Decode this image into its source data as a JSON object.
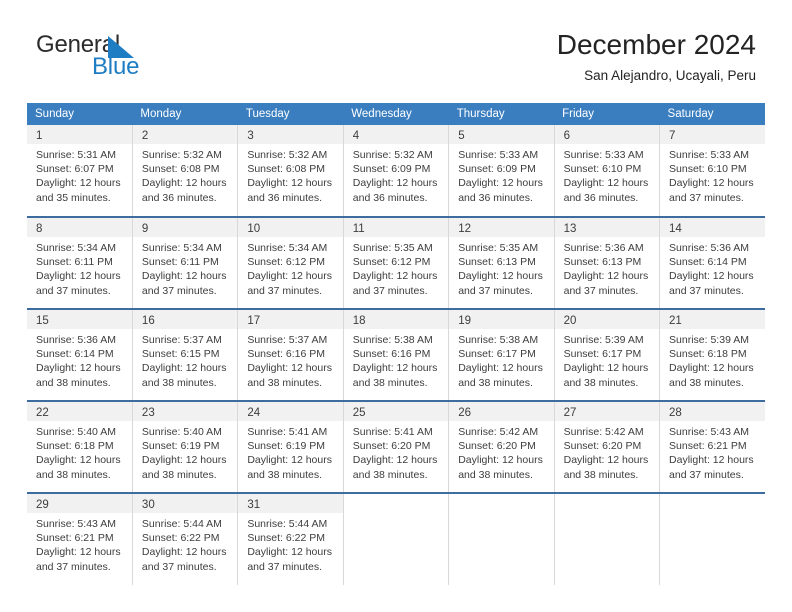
{
  "brand": {
    "name_part1": "General",
    "name_part2": "Blue",
    "triangle_color": "#1f7dc4",
    "text_color": "#2b2b2b"
  },
  "header": {
    "month_title": "December 2024",
    "location": "San Alejandro, Ucayali, Peru"
  },
  "theme": {
    "header_blue": "#3a7ec0",
    "row_rule": "#3c6d9e",
    "daynum_bg": "#f1f1f1",
    "cell_border": "#d8d8d8",
    "text": "#3d3d3d"
  },
  "weekdays": [
    "Sunday",
    "Monday",
    "Tuesday",
    "Wednesday",
    "Thursday",
    "Friday",
    "Saturday"
  ],
  "labels": {
    "sunrise_prefix": "Sunrise:",
    "sunset_prefix": "Sunset:",
    "daylight_prefix": "Daylight:"
  },
  "weeks": [
    [
      {
        "day": "1",
        "sunrise": "Sunrise: 5:31 AM",
        "sunset": "Sunset: 6:07 PM",
        "daylight1": "Daylight: 12 hours",
        "daylight2": "and 35 minutes."
      },
      {
        "day": "2",
        "sunrise": "Sunrise: 5:32 AM",
        "sunset": "Sunset: 6:08 PM",
        "daylight1": "Daylight: 12 hours",
        "daylight2": "and 36 minutes."
      },
      {
        "day": "3",
        "sunrise": "Sunrise: 5:32 AM",
        "sunset": "Sunset: 6:08 PM",
        "daylight1": "Daylight: 12 hours",
        "daylight2": "and 36 minutes."
      },
      {
        "day": "4",
        "sunrise": "Sunrise: 5:32 AM",
        "sunset": "Sunset: 6:09 PM",
        "daylight1": "Daylight: 12 hours",
        "daylight2": "and 36 minutes."
      },
      {
        "day": "5",
        "sunrise": "Sunrise: 5:33 AM",
        "sunset": "Sunset: 6:09 PM",
        "daylight1": "Daylight: 12 hours",
        "daylight2": "and 36 minutes."
      },
      {
        "day": "6",
        "sunrise": "Sunrise: 5:33 AM",
        "sunset": "Sunset: 6:10 PM",
        "daylight1": "Daylight: 12 hours",
        "daylight2": "and 36 minutes."
      },
      {
        "day": "7",
        "sunrise": "Sunrise: 5:33 AM",
        "sunset": "Sunset: 6:10 PM",
        "daylight1": "Daylight: 12 hours",
        "daylight2": "and 37 minutes."
      }
    ],
    [
      {
        "day": "8",
        "sunrise": "Sunrise: 5:34 AM",
        "sunset": "Sunset: 6:11 PM",
        "daylight1": "Daylight: 12 hours",
        "daylight2": "and 37 minutes."
      },
      {
        "day": "9",
        "sunrise": "Sunrise: 5:34 AM",
        "sunset": "Sunset: 6:11 PM",
        "daylight1": "Daylight: 12 hours",
        "daylight2": "and 37 minutes."
      },
      {
        "day": "10",
        "sunrise": "Sunrise: 5:34 AM",
        "sunset": "Sunset: 6:12 PM",
        "daylight1": "Daylight: 12 hours",
        "daylight2": "and 37 minutes."
      },
      {
        "day": "11",
        "sunrise": "Sunrise: 5:35 AM",
        "sunset": "Sunset: 6:12 PM",
        "daylight1": "Daylight: 12 hours",
        "daylight2": "and 37 minutes."
      },
      {
        "day": "12",
        "sunrise": "Sunrise: 5:35 AM",
        "sunset": "Sunset: 6:13 PM",
        "daylight1": "Daylight: 12 hours",
        "daylight2": "and 37 minutes."
      },
      {
        "day": "13",
        "sunrise": "Sunrise: 5:36 AM",
        "sunset": "Sunset: 6:13 PM",
        "daylight1": "Daylight: 12 hours",
        "daylight2": "and 37 minutes."
      },
      {
        "day": "14",
        "sunrise": "Sunrise: 5:36 AM",
        "sunset": "Sunset: 6:14 PM",
        "daylight1": "Daylight: 12 hours",
        "daylight2": "and 37 minutes."
      }
    ],
    [
      {
        "day": "15",
        "sunrise": "Sunrise: 5:36 AM",
        "sunset": "Sunset: 6:14 PM",
        "daylight1": "Daylight: 12 hours",
        "daylight2": "and 38 minutes."
      },
      {
        "day": "16",
        "sunrise": "Sunrise: 5:37 AM",
        "sunset": "Sunset: 6:15 PM",
        "daylight1": "Daylight: 12 hours",
        "daylight2": "and 38 minutes."
      },
      {
        "day": "17",
        "sunrise": "Sunrise: 5:37 AM",
        "sunset": "Sunset: 6:16 PM",
        "daylight1": "Daylight: 12 hours",
        "daylight2": "and 38 minutes."
      },
      {
        "day": "18",
        "sunrise": "Sunrise: 5:38 AM",
        "sunset": "Sunset: 6:16 PM",
        "daylight1": "Daylight: 12 hours",
        "daylight2": "and 38 minutes."
      },
      {
        "day": "19",
        "sunrise": "Sunrise: 5:38 AM",
        "sunset": "Sunset: 6:17 PM",
        "daylight1": "Daylight: 12 hours",
        "daylight2": "and 38 minutes."
      },
      {
        "day": "20",
        "sunrise": "Sunrise: 5:39 AM",
        "sunset": "Sunset: 6:17 PM",
        "daylight1": "Daylight: 12 hours",
        "daylight2": "and 38 minutes."
      },
      {
        "day": "21",
        "sunrise": "Sunrise: 5:39 AM",
        "sunset": "Sunset: 6:18 PM",
        "daylight1": "Daylight: 12 hours",
        "daylight2": "and 38 minutes."
      }
    ],
    [
      {
        "day": "22",
        "sunrise": "Sunrise: 5:40 AM",
        "sunset": "Sunset: 6:18 PM",
        "daylight1": "Daylight: 12 hours",
        "daylight2": "and 38 minutes."
      },
      {
        "day": "23",
        "sunrise": "Sunrise: 5:40 AM",
        "sunset": "Sunset: 6:19 PM",
        "daylight1": "Daylight: 12 hours",
        "daylight2": "and 38 minutes."
      },
      {
        "day": "24",
        "sunrise": "Sunrise: 5:41 AM",
        "sunset": "Sunset: 6:19 PM",
        "daylight1": "Daylight: 12 hours",
        "daylight2": "and 38 minutes."
      },
      {
        "day": "25",
        "sunrise": "Sunrise: 5:41 AM",
        "sunset": "Sunset: 6:20 PM",
        "daylight1": "Daylight: 12 hours",
        "daylight2": "and 38 minutes."
      },
      {
        "day": "26",
        "sunrise": "Sunrise: 5:42 AM",
        "sunset": "Sunset: 6:20 PM",
        "daylight1": "Daylight: 12 hours",
        "daylight2": "and 38 minutes."
      },
      {
        "day": "27",
        "sunrise": "Sunrise: 5:42 AM",
        "sunset": "Sunset: 6:20 PM",
        "daylight1": "Daylight: 12 hours",
        "daylight2": "and 38 minutes."
      },
      {
        "day": "28",
        "sunrise": "Sunrise: 5:43 AM",
        "sunset": "Sunset: 6:21 PM",
        "daylight1": "Daylight: 12 hours",
        "daylight2": "and 37 minutes."
      }
    ],
    [
      {
        "day": "29",
        "sunrise": "Sunrise: 5:43 AM",
        "sunset": "Sunset: 6:21 PM",
        "daylight1": "Daylight: 12 hours",
        "daylight2": "and 37 minutes."
      },
      {
        "day": "30",
        "sunrise": "Sunrise: 5:44 AM",
        "sunset": "Sunset: 6:22 PM",
        "daylight1": "Daylight: 12 hours",
        "daylight2": "and 37 minutes."
      },
      {
        "day": "31",
        "sunrise": "Sunrise: 5:44 AM",
        "sunset": "Sunset: 6:22 PM",
        "daylight1": "Daylight: 12 hours",
        "daylight2": "and 37 minutes."
      },
      {
        "day": "",
        "sunrise": "",
        "sunset": "",
        "daylight1": "",
        "daylight2": ""
      },
      {
        "day": "",
        "sunrise": "",
        "sunset": "",
        "daylight1": "",
        "daylight2": ""
      },
      {
        "day": "",
        "sunrise": "",
        "sunset": "",
        "daylight1": "",
        "daylight2": ""
      },
      {
        "day": "",
        "sunrise": "",
        "sunset": "",
        "daylight1": "",
        "daylight2": ""
      }
    ]
  ]
}
